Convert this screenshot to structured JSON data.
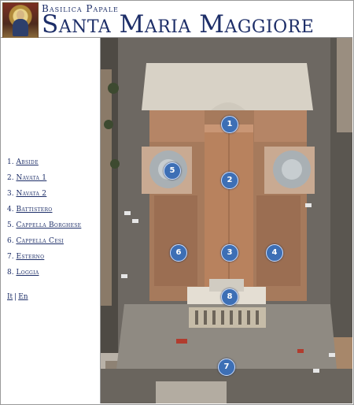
{
  "header": {
    "subtitle": "Basilica Papale",
    "title": "Santa Maria Maggiore"
  },
  "menu": {
    "items": [
      {
        "number": "1.",
        "label": "Abside"
      },
      {
        "number": "2.",
        "label": "Navata 1"
      },
      {
        "number": "3.",
        "label": "Navata 2"
      },
      {
        "number": "4.",
        "label": "Battistero"
      },
      {
        "number": "5.",
        "label": "Cappella Borghese"
      },
      {
        "number": "6.",
        "label": "Cappella Cesi"
      },
      {
        "number": "7.",
        "label": "Esterno"
      },
      {
        "number": "8.",
        "label": "Loggia"
      }
    ]
  },
  "language": {
    "it": "It",
    "separator": "|",
    "en": "En"
  },
  "map": {
    "markers": [
      "1",
      "2",
      "3",
      "4",
      "5",
      "6",
      "7",
      "8"
    ]
  },
  "colors": {
    "title_blue": "#1d2e68",
    "marker_blue": "#3d6fb5"
  }
}
